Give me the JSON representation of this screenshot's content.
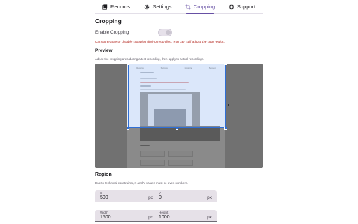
{
  "tabs": [
    {
      "label": "Records",
      "icon": "records-icon",
      "active": false
    },
    {
      "label": "Settings",
      "icon": "gear-icon",
      "active": false
    },
    {
      "label": "Cropping",
      "icon": "crop-icon",
      "active": true
    },
    {
      "label": "Support",
      "icon": "support-icon",
      "active": false
    }
  ],
  "cropping": {
    "title": "Cropping",
    "enable_label": "Enable Cropping",
    "enabled": false,
    "warning": "Cannot enable or disable cropping during recording. You can still adjust the crop region."
  },
  "preview": {
    "title": "Preview",
    "description": "Adjust the cropping area during a test recording, then apply to actual recordings."
  },
  "region": {
    "title": "Region",
    "note": "Due to technical constraints, X and Y values must be even numbers.",
    "fields": {
      "x": {
        "label": "X",
        "value": "500",
        "unit": "px"
      },
      "y": {
        "label": "Y",
        "value": "0",
        "unit": "px"
      },
      "width": {
        "label": "Width",
        "value": "1500",
        "unit": "px"
      },
      "height": {
        "label": "Height",
        "value": "1000",
        "unit": "px"
      }
    }
  },
  "colors": {
    "accent": "#6750a4",
    "warning": "#b3261e",
    "crop_outline": "#2f6fd6"
  }
}
